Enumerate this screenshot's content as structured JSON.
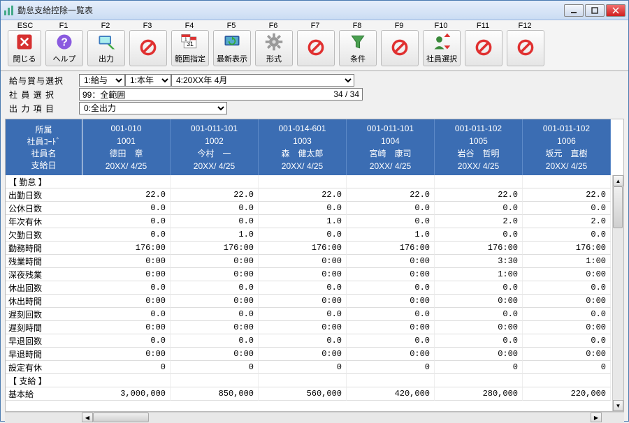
{
  "window": {
    "title": "勤怠支給控除一覧表"
  },
  "fkeys": [
    "ESC",
    "F1",
    "F2",
    "F3",
    "F4",
    "F5",
    "F6",
    "F7",
    "F8",
    "F9",
    "F10",
    "F11",
    "F12"
  ],
  "toolbar": [
    {
      "name": "close-button",
      "label": "閉じる",
      "icon": "close"
    },
    {
      "name": "help-button",
      "label": "ヘルプ",
      "icon": "help"
    },
    {
      "name": "output-button",
      "label": "出力",
      "icon": "output"
    },
    {
      "name": "f3-button",
      "label": "",
      "icon": "prohibit"
    },
    {
      "name": "range-button",
      "label": "範囲指定",
      "icon": "calendar"
    },
    {
      "name": "refresh-button",
      "label": "最新表示",
      "icon": "refresh"
    },
    {
      "name": "format-button",
      "label": "形式",
      "icon": "gear"
    },
    {
      "name": "f7-button",
      "label": "",
      "icon": "prohibit"
    },
    {
      "name": "filter-button",
      "label": "条件",
      "icon": "funnel"
    },
    {
      "name": "f9-button",
      "label": "",
      "icon": "prohibit"
    },
    {
      "name": "emp-select-button",
      "label": "社員選択",
      "icon": "emp"
    },
    {
      "name": "f11-button",
      "label": "",
      "icon": "prohibit"
    },
    {
      "name": "f12-button",
      "label": "",
      "icon": "prohibit"
    }
  ],
  "filters": {
    "row1_label": "給与賞与選択",
    "select_type": "1:給与",
    "select_year": "1:本年",
    "select_month": "4:20XX年 4月",
    "row2_label": "社 員 選 択",
    "emp_range": "99：全範囲",
    "emp_count": "34 / 34",
    "row3_label": "出 力 項 目",
    "output_sel": "0:全出力"
  },
  "header_labels": {
    "affil": "所属",
    "code": "社員ｺｰﾄﾞ",
    "name": "社員名",
    "paydate": "支給日"
  },
  "employees": [
    {
      "affil": "001-010",
      "code": "1001",
      "name": "德田　章",
      "paydate": "20XX/ 4/25"
    },
    {
      "affil": "001-011-101",
      "code": "1002",
      "name": "今村　一",
      "paydate": "20XX/ 4/25"
    },
    {
      "affil": "001-014-601",
      "code": "1003",
      "name": "森　健太郎",
      "paydate": "20XX/ 4/25"
    },
    {
      "affil": "001-011-101",
      "code": "1004",
      "name": "宮崎　康司",
      "paydate": "20XX/ 4/25"
    },
    {
      "affil": "001-011-102",
      "code": "1005",
      "name": "岩谷　哲明",
      "paydate": "20XX/ 4/25"
    },
    {
      "affil": "001-011-102",
      "code": "1006",
      "name": "坂元　直樹",
      "paydate": "20XX/ 4/25"
    }
  ],
  "sections": {
    "kintai": "【 勤怠 】",
    "shikyu": "【 支給 】"
  },
  "rows": [
    {
      "label": "出勤日数",
      "v": [
        "22.0",
        "22.0",
        "22.0",
        "22.0",
        "22.0",
        "22.0"
      ]
    },
    {
      "label": "公休日数",
      "v": [
        "0.0",
        "0.0",
        "0.0",
        "0.0",
        "0.0",
        "0.0"
      ]
    },
    {
      "label": "年次有休",
      "v": [
        "0.0",
        "0.0",
        "1.0",
        "0.0",
        "2.0",
        "2.0"
      ]
    },
    {
      "label": "欠勤日数",
      "v": [
        "0.0",
        "1.0",
        "0.0",
        "1.0",
        "0.0",
        "0.0"
      ]
    },
    {
      "label": "勤務時間",
      "v": [
        "176:00",
        "176:00",
        "176:00",
        "176:00",
        "176:00",
        "176:00"
      ]
    },
    {
      "label": "残業時間",
      "v": [
        "0:00",
        "0:00",
        "0:00",
        "0:00",
        "3:30",
        "1:00"
      ]
    },
    {
      "label": "深夜残業",
      "v": [
        "0:00",
        "0:00",
        "0:00",
        "0:00",
        "1:00",
        "0:00"
      ]
    },
    {
      "label": "休出回数",
      "v": [
        "0.0",
        "0.0",
        "0.0",
        "0.0",
        "0.0",
        "0.0"
      ]
    },
    {
      "label": "休出時間",
      "v": [
        "0:00",
        "0:00",
        "0:00",
        "0:00",
        "0:00",
        "0:00"
      ]
    },
    {
      "label": "遅刻回数",
      "v": [
        "0.0",
        "0.0",
        "0.0",
        "0.0",
        "0.0",
        "0.0"
      ]
    },
    {
      "label": "遅刻時間",
      "v": [
        "0:00",
        "0:00",
        "0:00",
        "0:00",
        "0:00",
        "0:00"
      ]
    },
    {
      "label": "早退回数",
      "v": [
        "0.0",
        "0.0",
        "0.0",
        "0.0",
        "0.0",
        "0.0"
      ]
    },
    {
      "label": "早退時間",
      "v": [
        "0:00",
        "0:00",
        "0:00",
        "0:00",
        "0:00",
        "0:00"
      ]
    },
    {
      "label": "設定有休",
      "v": [
        "0",
        "0",
        "0",
        "0",
        "0",
        "0"
      ]
    }
  ],
  "pay_rows": [
    {
      "label": "基本給",
      "v": [
        "3,000,000",
        "850,000",
        "560,000",
        "420,000",
        "280,000",
        "220,000"
      ]
    }
  ]
}
